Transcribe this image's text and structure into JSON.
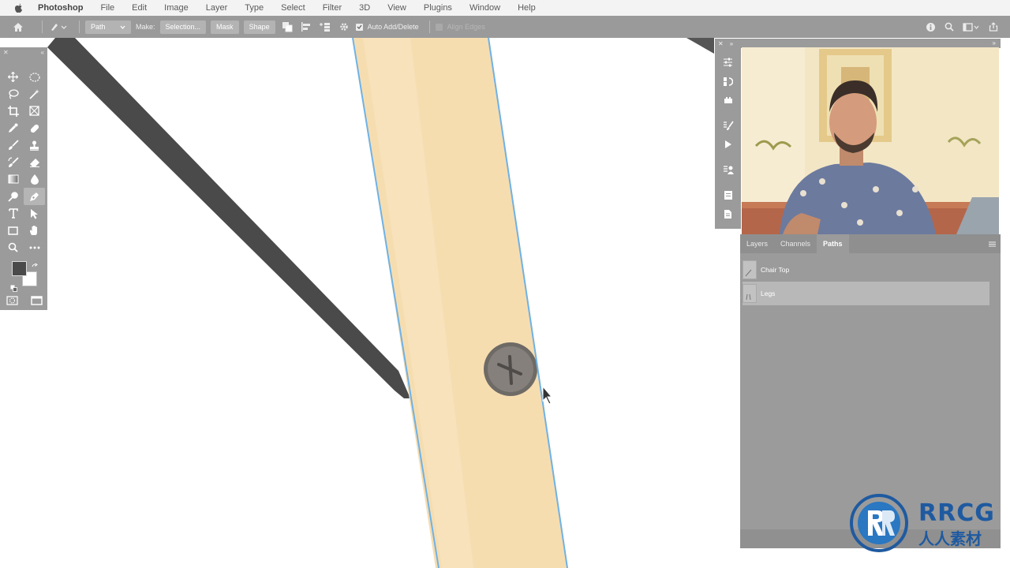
{
  "menubar": {
    "app_name": "Photoshop",
    "items": [
      "File",
      "Edit",
      "Image",
      "Layer",
      "Type",
      "Select",
      "Filter",
      "3D",
      "View",
      "Plugins",
      "Window",
      "Help"
    ]
  },
  "options_bar": {
    "mode_select": "Path",
    "make_label": "Make:",
    "selection_button": "Selection...",
    "mask_button": "Mask",
    "shape_button": "Shape",
    "auto_add_delete_label": "Auto Add/Delete",
    "auto_add_delete_checked": true,
    "align_edges_label": "Align Edges",
    "align_edges_enabled": false
  },
  "paths_panel": {
    "tabs": [
      {
        "label": "Layers",
        "active": false
      },
      {
        "label": "Channels",
        "active": false
      },
      {
        "label": "Paths",
        "active": true
      }
    ],
    "paths": [
      {
        "name": "Chair Top",
        "selected": false
      },
      {
        "name": "Legs",
        "selected": true
      }
    ]
  },
  "watermark": {
    "brand": "RRCG",
    "subtitle": "人人素材"
  },
  "colors": {
    "panel_gray": "#9b9b9b",
    "path_stroke": "#6fb2e6",
    "wood": "#f6ddb0",
    "dark_leg": "#4a4a4a",
    "watermark_blue": "#1f5aa0"
  },
  "tool_icons": [
    "move-icon",
    "marquee-icon",
    "lasso-icon",
    "magic-wand-icon",
    "crop-icon",
    "frame-icon",
    "eyedropper-icon",
    "healing-icon",
    "brush-icon",
    "stamp-icon",
    "history-brush-icon",
    "eraser-icon",
    "gradient-icon",
    "blur-icon",
    "dodge-icon",
    "pen-icon",
    "type-icon",
    "path-select-icon",
    "rectangle-icon",
    "hand-icon",
    "zoom-icon",
    "more-tools-icon"
  ]
}
